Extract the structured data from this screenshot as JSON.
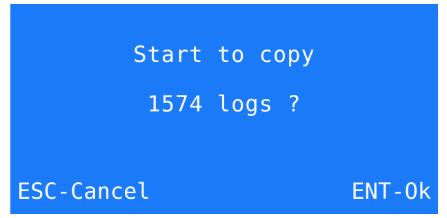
{
  "dialog": {
    "message_line_1": "Start to copy",
    "message_line_2": "1574 logs ?"
  },
  "softkeys": {
    "cancel_label": "ESC-Cancel",
    "ok_label": "ENT-Ok"
  },
  "colors": {
    "background": "#1a7af8",
    "text": "#ffffff"
  }
}
